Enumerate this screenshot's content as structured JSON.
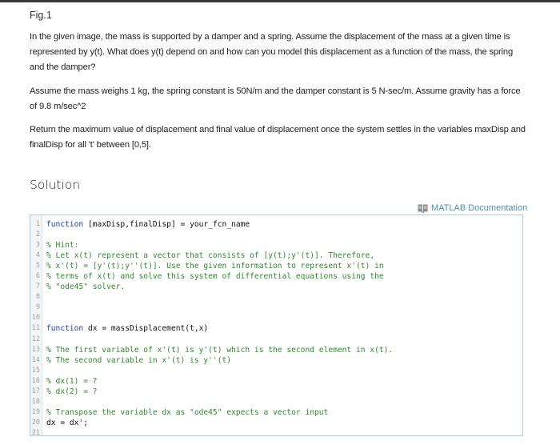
{
  "header": {
    "fig_label": "Fig.1"
  },
  "problem": {
    "paragraphs": [
      "In the given image, the mass is supported by a damper and a spring. Assume the displacement of the mass at a given time is represented by y(t). What does y(t) depend on and how can you model this displacement as a function of the mass, the spring and the damper?",
      "Assume the mass weighs 1 kg, the spring constant is 50N/m and the damper constant is 5 N-sec/m. Assume gravity has a force of 9.8 m/sec^2",
      "Return the maximum value of displacement and final value of displacement once the system settles in the variables maxDisp and finalDisp for all 't' between [0,5]."
    ]
  },
  "solution": {
    "title": "Solution",
    "doc_link": {
      "label": "MATLAB Documentation",
      "icon": "book-icon"
    },
    "editor": {
      "colors": {
        "keyword": "#1b3fa6",
        "comment": "#2e8a2e",
        "border": "#a9cde0",
        "link": "#4a8fb8"
      },
      "lines": [
        {
          "n": "1",
          "kw": "function",
          "code": " [maxDisp,finalDisp] = your_fcn_name",
          "comment": ""
        },
        {
          "n": "2",
          "kw": "",
          "code": "",
          "comment": ""
        },
        {
          "n": "3",
          "kw": "",
          "code": "",
          "comment": "% Hint:"
        },
        {
          "n": "4",
          "kw": "",
          "code": "",
          "comment": "% Let x(t) represent a vector that consists of [y(t);y'(t)]. Therefore,"
        },
        {
          "n": "5",
          "kw": "",
          "code": "",
          "comment": "% x'(t) = [y'(t);y''(t)]. Use the given information to represent x'(t) in"
        },
        {
          "n": "6",
          "kw": "",
          "code": "",
          "comment": "% terms of x(t) and solve this system of differential equations using the"
        },
        {
          "n": "7",
          "kw": "",
          "code": "",
          "comment": "% \"ode45\" solver."
        },
        {
          "n": "8",
          "kw": "",
          "code": "",
          "comment": ""
        },
        {
          "n": "9",
          "kw": "",
          "code": "",
          "comment": ""
        },
        {
          "n": "10",
          "kw": "",
          "code": "",
          "comment": ""
        },
        {
          "n": "11",
          "kw": "function",
          "code": " dx = massDisplacement(t,x)",
          "comment": ""
        },
        {
          "n": "12",
          "kw": "",
          "code": "",
          "comment": ""
        },
        {
          "n": "13",
          "kw": "",
          "code": "",
          "comment": "% The first variable of x'(t) is y'(t) which is the second element in x(t)."
        },
        {
          "n": "14",
          "kw": "",
          "code": "",
          "comment": "% The second variable in x'(t) is y''(t)"
        },
        {
          "n": "15",
          "kw": "",
          "code": "",
          "comment": ""
        },
        {
          "n": "16",
          "kw": "",
          "code": "",
          "comment": "% dx(1) = ?"
        },
        {
          "n": "17",
          "kw": "",
          "code": "",
          "comment": "% dx(2) = ?"
        },
        {
          "n": "18",
          "kw": "",
          "code": "",
          "comment": ""
        },
        {
          "n": "19",
          "kw": "",
          "code": "",
          "comment": "% Transpose the variable dx as \"ode45\" expects a vector input"
        },
        {
          "n": "20",
          "kw": "",
          "code": "dx = dx';",
          "comment": ""
        },
        {
          "n": "21",
          "kw": "",
          "code": "",
          "comment": ""
        }
      ]
    }
  }
}
